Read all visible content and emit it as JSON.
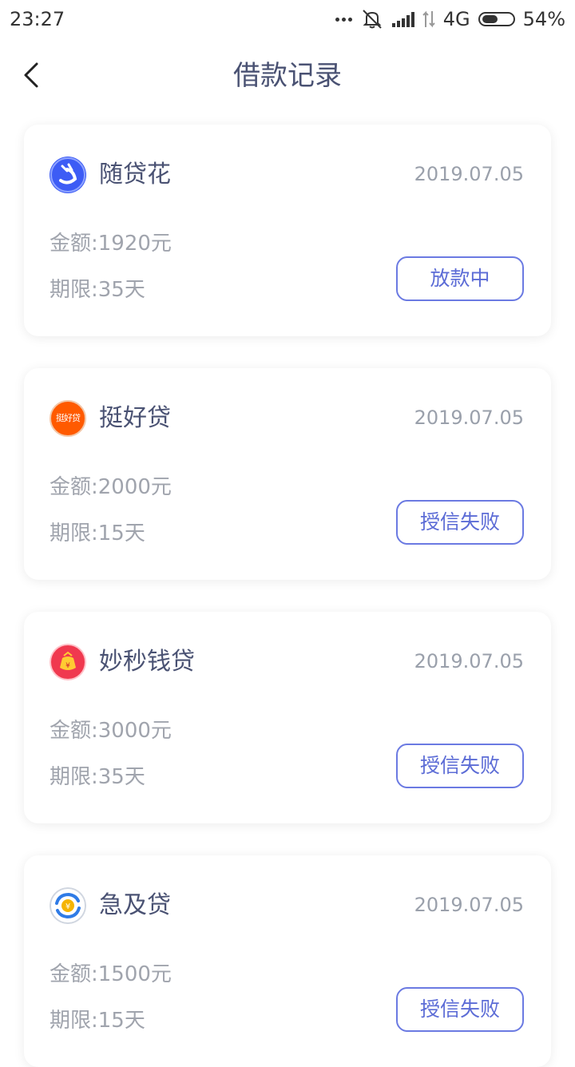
{
  "status_bar": {
    "time": "23:27",
    "network": "4G",
    "battery": "54%",
    "battery_level": 0.54,
    "icons": [
      "more-dots-icon",
      "mute-icon",
      "signal-icon",
      "data-arrows-icon",
      "battery-icon"
    ]
  },
  "header": {
    "title": "借款记录",
    "back_icon": "chevron-left-icon"
  },
  "labels": {
    "amount": "金额:",
    "term": "期限:"
  },
  "records": [
    {
      "name": "随贷花",
      "date": "2019.07.05",
      "amount": "1920元",
      "term": "35天",
      "status": "放款中",
      "logo_icon": "suidaihua-logo-icon",
      "logo_color": "#3d5cf5"
    },
    {
      "name": "挺好贷",
      "date": "2019.07.05",
      "amount": "2000元",
      "term": "15天",
      "status": "授信失败",
      "logo_icon": "tinghaodai-logo-icon",
      "logo_color": "#ff5a00",
      "logo_text": "挺好贷"
    },
    {
      "name": "妙秒钱贷",
      "date": "2019.07.05",
      "amount": "3000元",
      "term": "35天",
      "status": "授信失败",
      "logo_icon": "miaomiaoqiandai-logo-icon",
      "logo_color": "#f0394f"
    },
    {
      "name": "急及贷",
      "date": "2019.07.05",
      "amount": "1500元",
      "term": "15天",
      "status": "授信失败",
      "logo_icon": "jijidai-logo-icon",
      "logo_color": "#2f7be6"
    }
  ],
  "colors": {
    "title": "#4a5273",
    "accent": "#6b7ae2",
    "muted": "#a0a4ad"
  }
}
